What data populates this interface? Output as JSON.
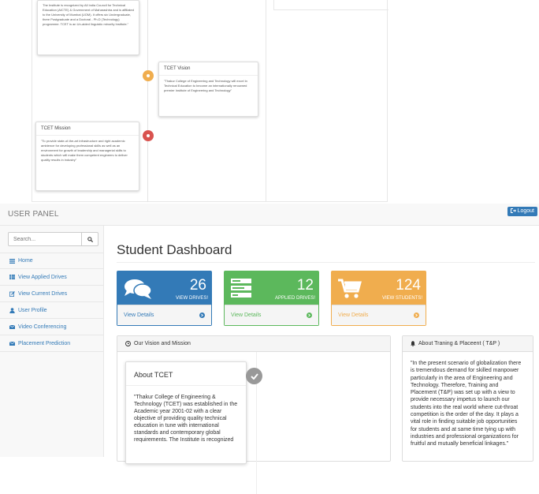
{
  "top_snippet": {
    "cards": [
      {
        "title": "",
        "body": "The Institute is recognized by All India Council for Technical Education (AICTE) & Government of Maharashtra and is affiliated to the University of Mumbai (UOM). It offers six Undergraduate, three Postgraduate and a Doctoral - Ph.D (Technology) programme. TCET is an Un-aided linguistic minority Institute.\""
      },
      {
        "title": "TCET Vision",
        "body": "\"Thakur College of Engineering and Technology will excel in Technical Education to become an internationally renowned premier Institute of Engineering and Technology\""
      },
      {
        "title": "TCET Mission",
        "body": "\"To provide state-of-the-art infrastructure and right academic ambience for developing professional skills as well as an environment for growth of leadership and managerial skills to students which will make them competent engineers to deliver quality results in industry\""
      }
    ],
    "colors": {
      "vision_dot": "#f0ad4e",
      "mission_dot": "#d9534f"
    }
  },
  "navbar": {
    "brand": "USER PANEL",
    "logout_label": "Logout"
  },
  "sidebar": {
    "search_placeholder": "Search...",
    "items": [
      {
        "label": "Home",
        "icon": "dashboard-icon"
      },
      {
        "label": "View Applied Drives",
        "icon": "table-icon"
      },
      {
        "label": "View Current Drives",
        "icon": "edit-icon"
      },
      {
        "label": "User Profile",
        "icon": "user-icon"
      },
      {
        "label": "Video Conferencing",
        "icon": "envelope-icon"
      },
      {
        "label": "Placement Prediction",
        "icon": "envelope-icon"
      }
    ]
  },
  "main": {
    "title": "Student Dashboard",
    "stats": [
      {
        "value": "26",
        "label": "VIEW DRIVES!",
        "link": "View Details",
        "color": "#337ab7",
        "icon": "comments-icon"
      },
      {
        "value": "12",
        "label": "APPLIED DRIVES!",
        "link": "View Details",
        "color": "#5cb85c",
        "icon": "tasks-icon"
      },
      {
        "value": "124",
        "label": "VIEW STUDENTS!",
        "link": "View Details",
        "color": "#f0ad4e",
        "icon": "shopping-cart-icon"
      }
    ],
    "vision_panel": {
      "heading": "Our Vision and Mission",
      "card_title": "About TCET",
      "card_body": "\"Thakur College of Engineering & Technology (TCET) was established in the Academic year 2001-02 with a clear objective of providing quality technical education in tune with international standards and contemporary global requirements. The Institute is recognized"
    },
    "tp_panel": {
      "heading": "About Traning & Placeent ( T&P )",
      "body": "\"In the present scenario of globalization there is tremendous demand for skilled manpower particularly in the area of Engineering and Technology. Therefore, Training and Placement (T&P) was set up with a view to provide necessary impetus to launch our students into the real world where cut-throat competition is the order of the day. It plays a vital role in finding suitable job opportunities for students and at same time tying up with industries and professional organizations for fruitful and mutually beneficial linkages.\""
    }
  }
}
